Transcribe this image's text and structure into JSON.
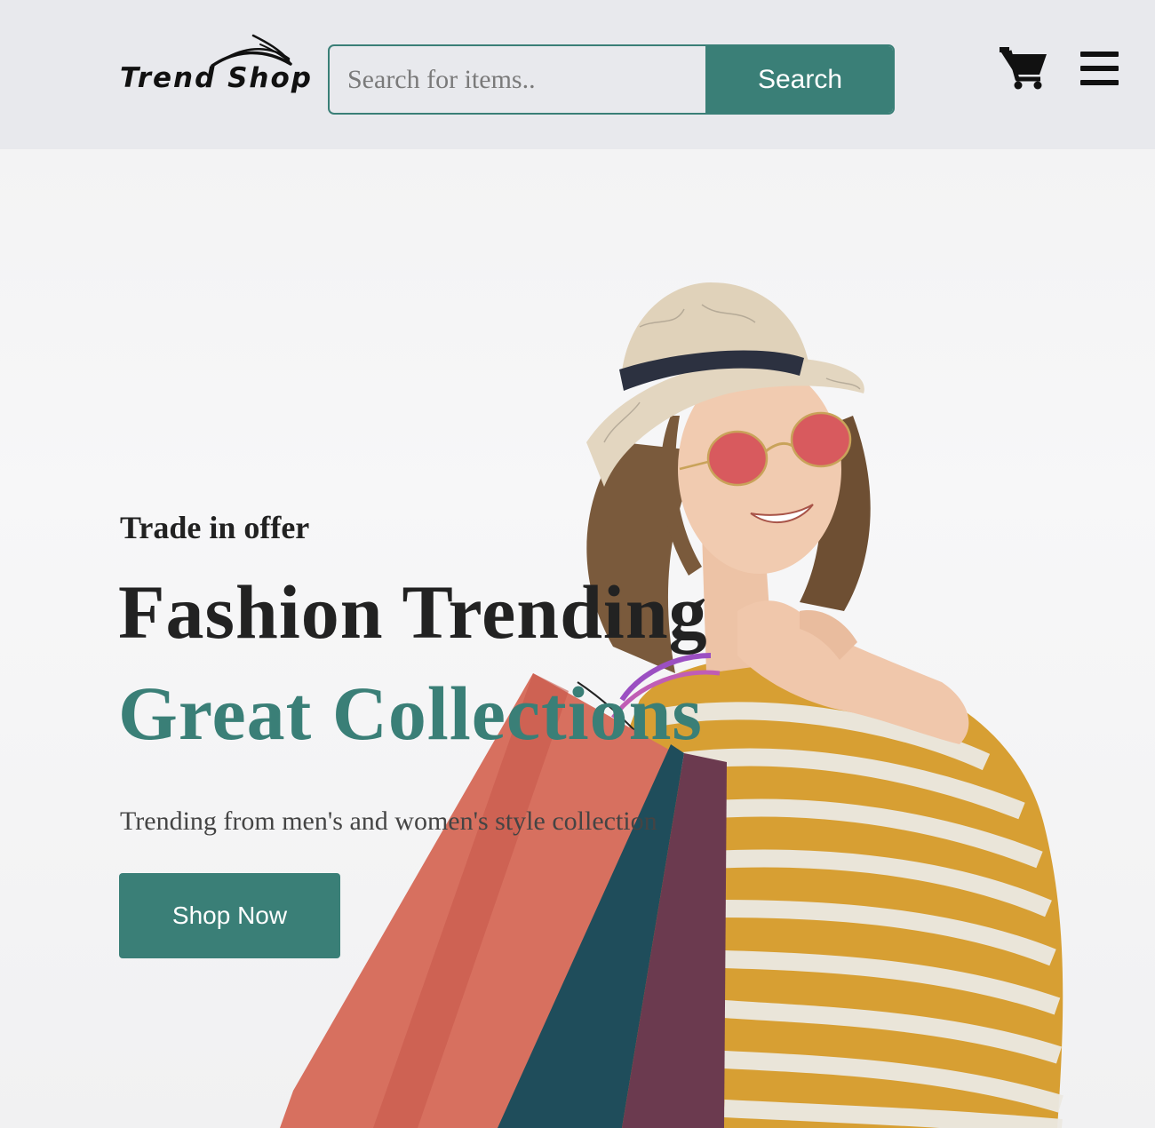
{
  "header": {
    "logo_text": "Trend Shop",
    "search": {
      "placeholder": "Search for items..",
      "value": "",
      "button_label": "Search"
    },
    "icons": [
      "cart-icon",
      "menu-icon"
    ]
  },
  "hero": {
    "tag": "Trade in offer",
    "title": "Fashion Trending",
    "subtitle": "Great Collections",
    "description": "Trending from men's and women's style collection",
    "cta_label": "Shop Now",
    "image_subject": "smiling woman in straw hat and red sunglasses holding shopping bags"
  },
  "colors": {
    "accent": "#3a7f77",
    "header_bg": "#e8e9ed",
    "text_dark": "#222222"
  }
}
